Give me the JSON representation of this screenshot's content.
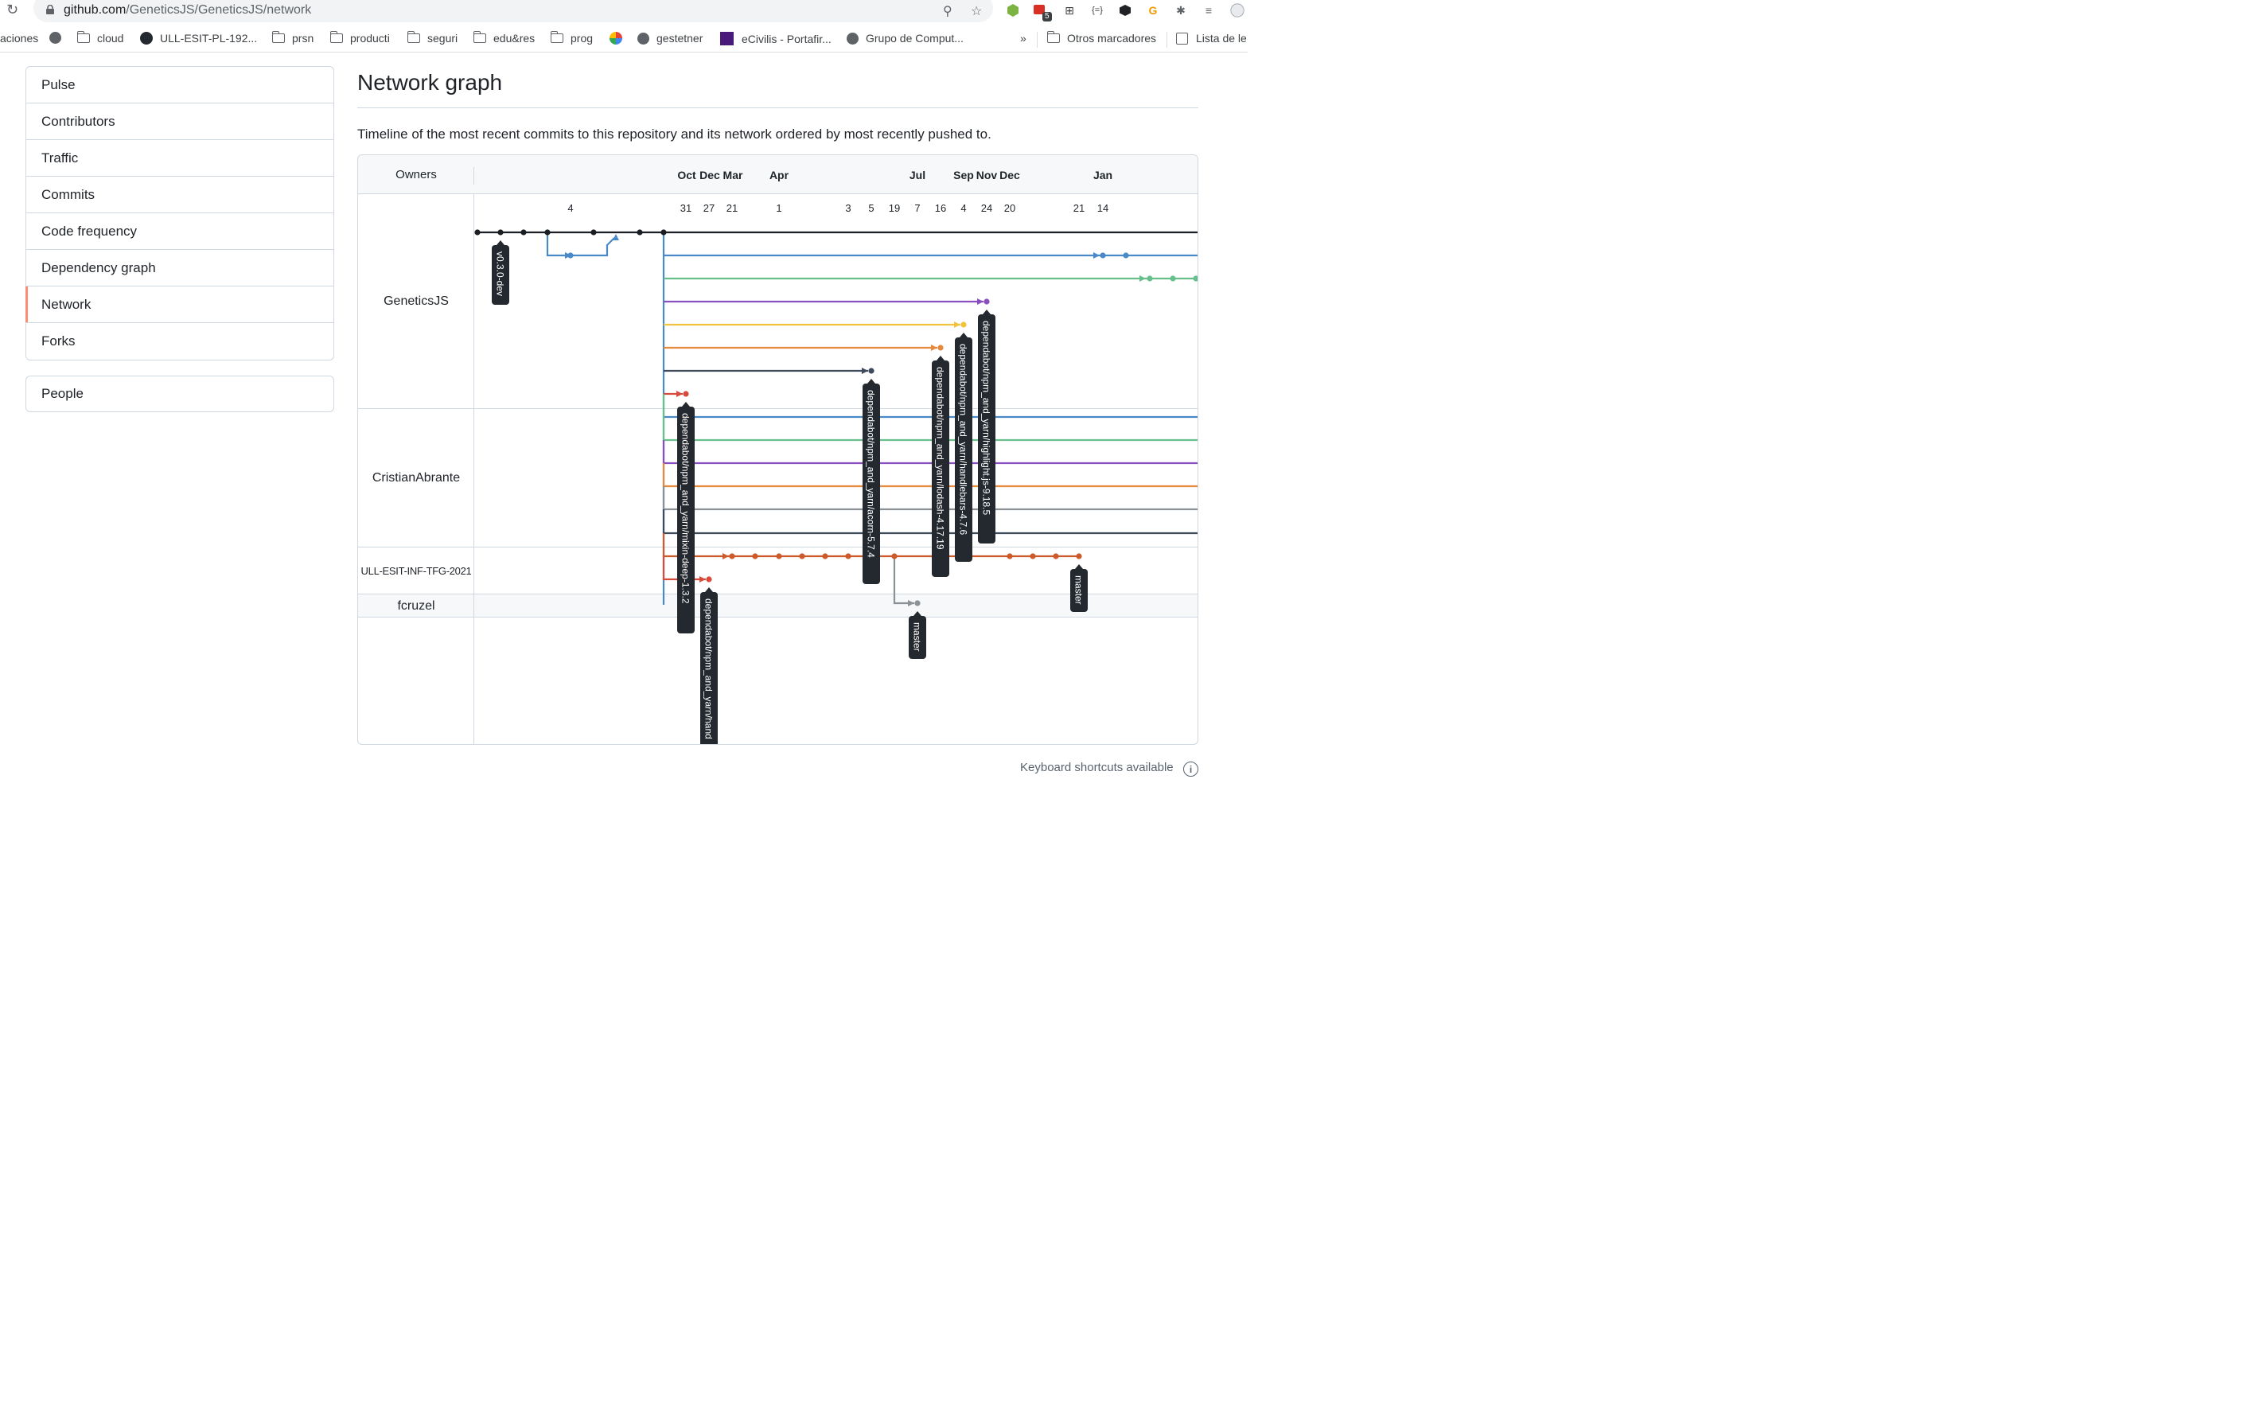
{
  "browser": {
    "url_host": "github.com",
    "url_path": "/GeneticsJS/GeneticsJS/network",
    "bookmarks": [
      {
        "label": "aciones",
        "icon": "none"
      },
      {
        "label": "",
        "icon": "globe-icon"
      },
      {
        "label": "cloud",
        "icon": "folder-icon"
      },
      {
        "label": "ULL-ESIT-PL-192...",
        "icon": "github-icon"
      },
      {
        "label": "prsn",
        "icon": "folder-icon"
      },
      {
        "label": "producti",
        "icon": "folder-icon"
      },
      {
        "label": "seguri",
        "icon": "folder-icon"
      },
      {
        "label": "edu&res",
        "icon": "folder-icon"
      },
      {
        "label": "prog",
        "icon": "folder-icon"
      },
      {
        "label": "",
        "icon": "pinwheel-icon"
      },
      {
        "label": "gestetner",
        "icon": "globe-icon"
      },
      {
        "label": "eCivilis - Portafir...",
        "icon": "ecivilis-icon"
      },
      {
        "label": "Grupo de Comput...",
        "icon": "globe-icon"
      }
    ],
    "overflow": "»",
    "other_bookmarks": "Otros marcadores",
    "reading_list": "Lista de le",
    "badge_count": "5"
  },
  "nav": {
    "items": [
      "Pulse",
      "Contributors",
      "Traffic",
      "Commits",
      "Code frequency",
      "Dependency graph",
      "Network",
      "Forks"
    ],
    "selected": "Network",
    "people": "People"
  },
  "page": {
    "title": "Network graph",
    "description": "Timeline of the most recent commits to this repository and its network ordered by most recently pushed to.",
    "keyboard": "Keyboard shortcuts available",
    "keyboard_icon": "i"
  },
  "graph": {
    "owners_header": "Owners",
    "owners": [
      "GeneticsJS",
      "CristianAbrante",
      "ULL-ESIT-INF-TFG-2021",
      "fcruzel"
    ],
    "months": [
      "Oct",
      "Dec",
      "Mar",
      "Apr",
      "Jul",
      "Sep",
      "Nov",
      "Dec",
      "Jan"
    ],
    "days": [
      "4",
      "31",
      "27",
      "21",
      "1",
      "3",
      "5",
      "19",
      "7",
      "16",
      "4",
      "24",
      "20",
      "21",
      "14"
    ],
    "labels": [
      "v0.3.0-dev",
      "dependabot/npm_and_yarn/mixin-deep-1.3.2",
      "dependabot/npm_and_yarn/hand",
      "dependabot/npm_and_yarn/acorn-5.7.4",
      "dependabot/npm_and_yarn/lodash-4.17.19",
      "dependabot/npm_and_yarn/handlebars-4.7.6",
      "dependabot/npm_and_yarn/highlight.js-9.18.5",
      "master",
      "master"
    ],
    "colors": {
      "black": "#1b1f23",
      "blue": "#4a89c8",
      "green": "#67c08b",
      "purple": "#8a4fbf",
      "yellow": "#f2c43d",
      "orange": "#e58a3c",
      "navy": "#3d4a5c",
      "red": "#d64b3c",
      "gray": "#8c9196",
      "rust": "#cc5a2a"
    }
  }
}
